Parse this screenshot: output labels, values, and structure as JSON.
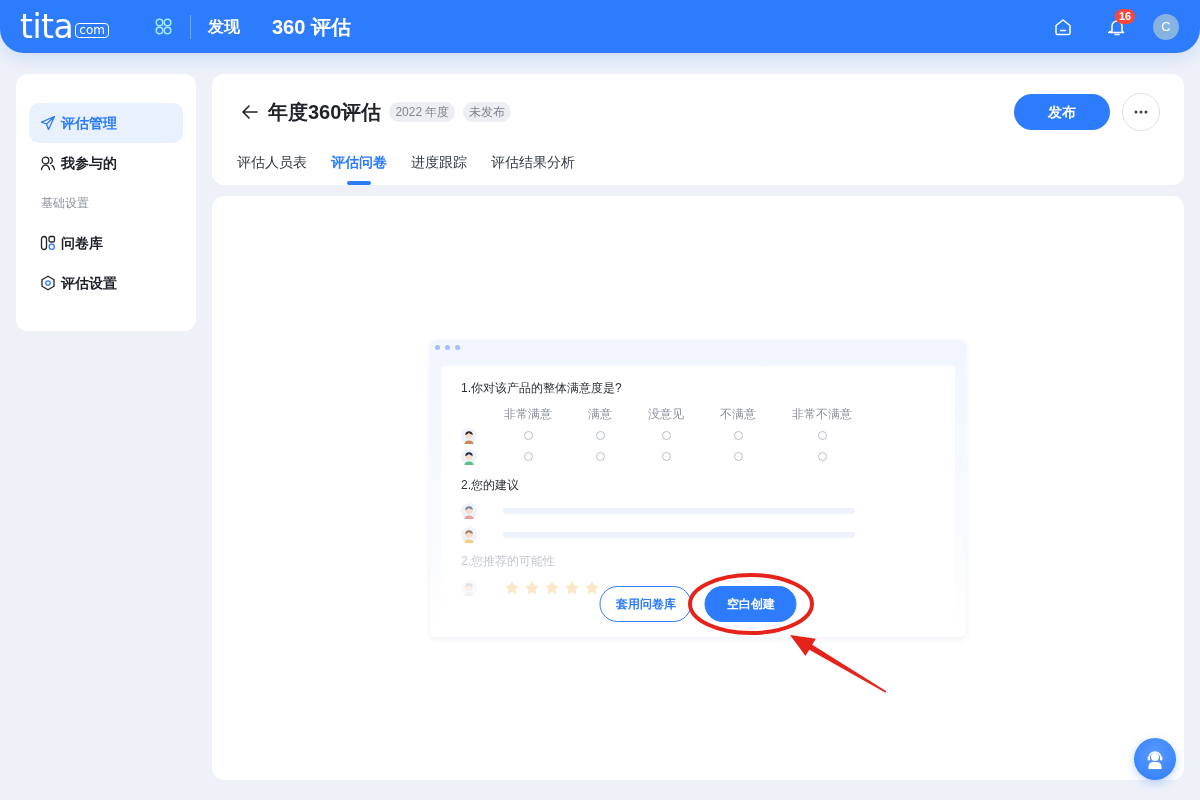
{
  "header": {
    "logo": {
      "name": "tita",
      "suffix": "com"
    },
    "nav_link": "发现",
    "app_title": "360 评估",
    "notification_count": "16",
    "avatar_initial": "C"
  },
  "sidebar": {
    "items": [
      {
        "kind": "link",
        "label": "评估管理",
        "selected": true
      },
      {
        "kind": "link",
        "label": "我参与的",
        "selected": false
      },
      {
        "kind": "heading",
        "label": "基础设置"
      },
      {
        "kind": "link",
        "label": "问卷库",
        "selected": false
      },
      {
        "kind": "link",
        "label": "评估设置",
        "selected": false
      }
    ]
  },
  "page_header": {
    "title": "年度360评估",
    "tags": [
      "2022 年度",
      "未发布"
    ],
    "tabs": [
      {
        "label": "评估人员表",
        "selected": false
      },
      {
        "label": "评估问卷",
        "selected": true
      },
      {
        "label": "进度跟踪",
        "selected": false
      },
      {
        "label": "评估结果分析",
        "selected": false
      }
    ],
    "publish_button": "发布"
  },
  "empty_state": {
    "preview": {
      "questions": [
        {
          "kind": "choice",
          "title": "1.你对该产品的整体满意度是?",
          "options": [
            "非常满意",
            "满意",
            "没意见",
            "不满意",
            "非常不满意"
          ],
          "rows": [
            {
              "checked": [
                false,
                false,
                false,
                false,
                false
              ]
            },
            {
              "checked": [
                false,
                false,
                false,
                false,
                false
              ]
            }
          ]
        },
        {
          "kind": "text",
          "title": "2.您的建议"
        },
        {
          "kind": "rating",
          "title": "2.您推荐的可能性",
          "rows": [
            {
              "stars": 5
            }
          ]
        }
      ]
    },
    "buttons": [
      {
        "kind": "outline",
        "label": "套用问卷库"
      },
      {
        "kind": "primary",
        "label": "空白创建"
      }
    ],
    "annotations": [
      {
        "kind": "ellipse"
      },
      {
        "kind": "arrow"
      }
    ]
  }
}
